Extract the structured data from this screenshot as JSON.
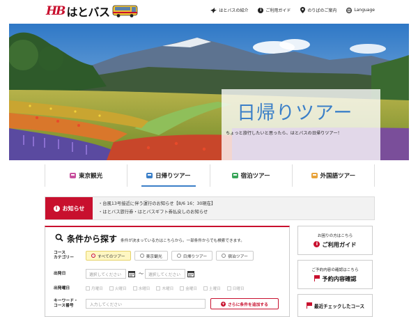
{
  "header": {
    "logo_mark": "HB",
    "logo_text": "はとバス",
    "nav": [
      {
        "icon": "bird-icon",
        "label": "はとバスの紹介"
      },
      {
        "icon": "info-icon",
        "label": "ご利用ガイド"
      },
      {
        "icon": "pin-icon",
        "label": "のりばのご案内"
      },
      {
        "icon": "globe-icon",
        "label": "Language"
      }
    ]
  },
  "hero": {
    "title": "日帰りツアー",
    "subtitle": "ちょっと旅行したいと思ったら、はとバスの日帰りツアー！"
  },
  "category_tabs": [
    {
      "label": "東京観光",
      "icon": "bus-icon",
      "color": "#c8509e",
      "active": false
    },
    {
      "label": "日帰りツアー",
      "icon": "bus-icon",
      "color": "#3b7fc8",
      "active": true
    },
    {
      "label": "宿泊ツアー",
      "icon": "bus-icon",
      "color": "#3aa65a",
      "active": false
    },
    {
      "label": "外国語ツアー",
      "icon": "bus-icon",
      "color": "#e8a33a",
      "active": false
    }
  ],
  "notices": {
    "label": "お知らせ",
    "items": [
      "・台風13号接近に伴う運行のお知らせ【8/6 16：30現在】",
      "・はとバス旅行券・はとバスギフト券払戻しのお知らせ"
    ]
  },
  "search": {
    "title": "条件から探す",
    "desc": "条件が決まっている方はこちらから。一部条件からでも検索できます。",
    "course_label_1": "コース",
    "course_label_2": "カテゴリー",
    "categories": [
      {
        "label": "すべてのツアー",
        "selected": true
      },
      {
        "label": "東京観光",
        "selected": false
      },
      {
        "label": "日帰りツアー",
        "selected": false
      },
      {
        "label": "宿泊ツアー",
        "selected": false
      }
    ],
    "date_label": "出発日",
    "date_placeholder": "選択してください",
    "date_sep": "〜",
    "dow_label": "出発曜日",
    "days": [
      "月曜日",
      "火曜日",
      "水曜日",
      "木曜日",
      "金曜日",
      "土曜日",
      "日曜日"
    ],
    "kw_label_1": "キーワード・",
    "kw_label_2": "コース番号",
    "kw_placeholder": "入力してください",
    "add_button": "さらに条件を追加する"
  },
  "side": [
    {
      "small": "お困りの方はこちら",
      "big": "ご利用ガイド",
      "icon": "info-icon"
    },
    {
      "small": "ご予約内容の確認はこちら",
      "big": "予約内容確認",
      "icon": "flag-icon"
    },
    {
      "small": "",
      "big": "最近チェックしたコース",
      "icon": "flag-icon"
    }
  ],
  "colors": {
    "brand_red": "#c8102e",
    "accent_blue": "#3b7fc8"
  }
}
